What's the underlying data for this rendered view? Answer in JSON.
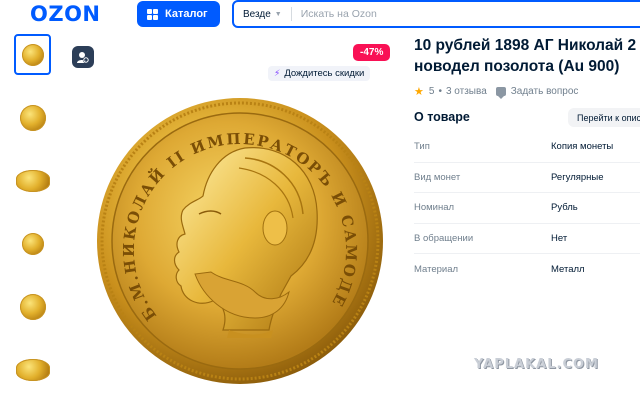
{
  "header": {
    "logo": "OZON",
    "catalog_label": "Каталог",
    "search_scope": "Везде",
    "search_placeholder": "Искать на Ozon"
  },
  "gallery": {
    "thumbnail_count": 6,
    "active_index": 0
  },
  "product": {
    "discount": "-47%",
    "wait_discount_label": "Дождитесь скидки",
    "title_line1": "10 рублей 1898 АГ Николай 2",
    "title_line2": "новодел позолота (Au 900)",
    "rating": "5",
    "reviews": "3 отзыва",
    "ask_question": "Задать вопрос"
  },
  "about": {
    "title": "О товаре",
    "goto_label": "Перейти к описанию",
    "specs": [
      {
        "name": "Тип",
        "value": "Копия монеты"
      },
      {
        "name": "Вид монет",
        "value": "Регулярные"
      },
      {
        "name": "Номинал",
        "value": "Рубль"
      },
      {
        "name": "В обращении",
        "value": "Нет"
      },
      {
        "name": "Материал",
        "value": "Металл"
      }
    ]
  },
  "coin": {
    "inscription": "Б.М.НИКОЛАЙ II ИМПЕРАТОРЪ И САМОДЕРЖЕЦЪ ВСЕРОСС."
  },
  "watermark": "YAPLAKAL.COM",
  "colors": {
    "brand_blue": "#005bff",
    "discount_pink": "#f91155",
    "star": "#ffa800",
    "gold": "#d9a52a"
  },
  "icons": [
    "grid-icon",
    "chevron-down-icon",
    "share-icon",
    "lightning-icon",
    "star-icon",
    "chat-icon"
  ]
}
